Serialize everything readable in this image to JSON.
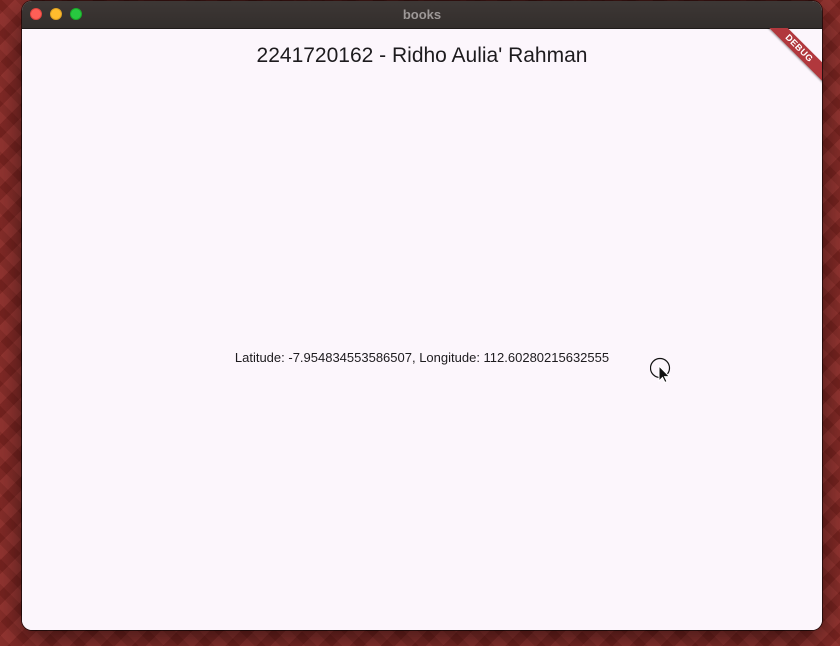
{
  "window": {
    "title": "books"
  },
  "app": {
    "title": "2241720162 - Ridho Aulia' Rahman",
    "location_text": "Latitude: -7.954834553586507, Longitude: 112.60280215632555"
  },
  "debug_banner": {
    "label": "DEBUG"
  },
  "colors": {
    "desktop": "#8e2a26",
    "titlebar": "#3d3735",
    "content_bg": "#fcf6fc",
    "debug_ribbon": "#b1383d",
    "close": "#fe5f57",
    "minimize": "#febc2e",
    "maximize": "#28c840"
  },
  "icons": {
    "cursor": "mouse-pointer-icon"
  }
}
